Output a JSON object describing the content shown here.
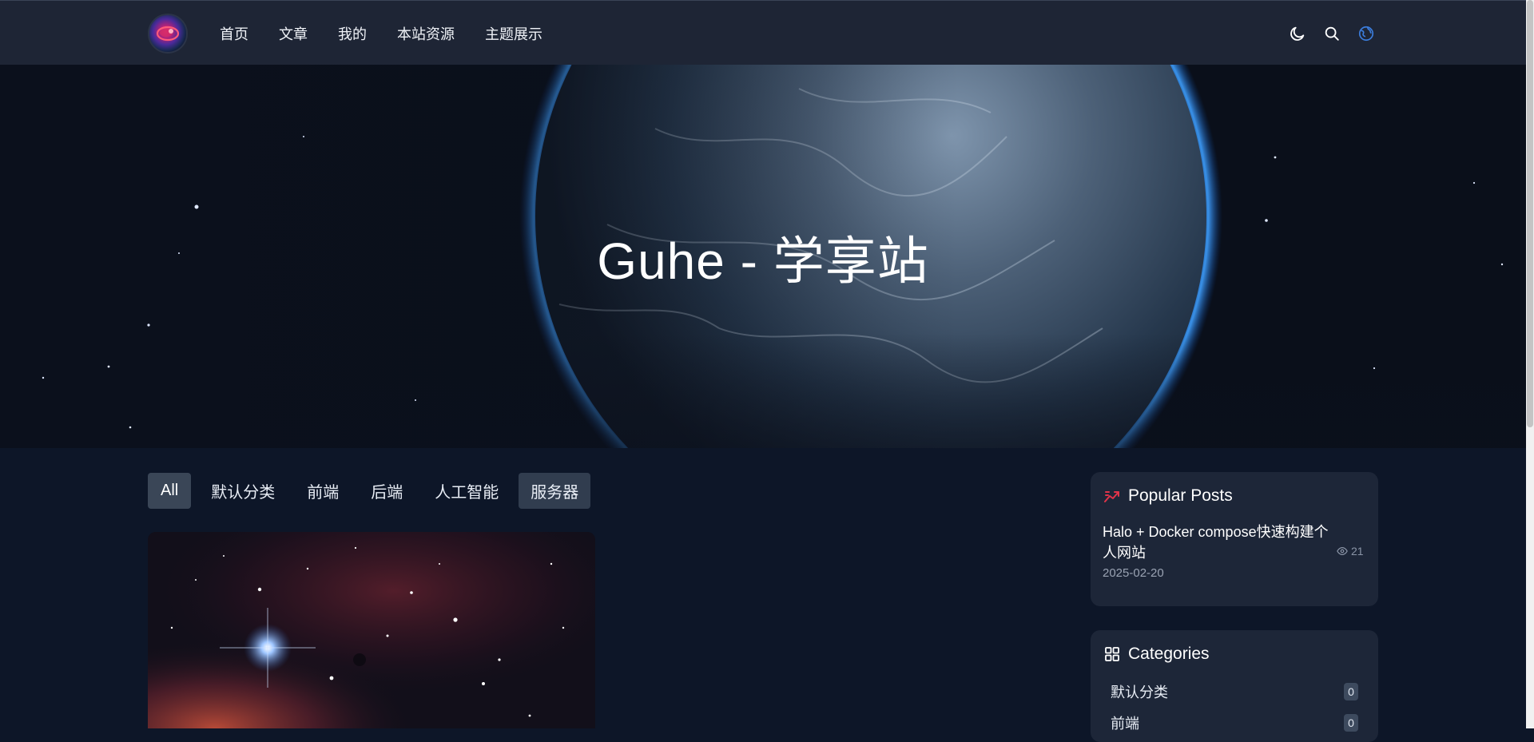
{
  "site": {
    "title": "Guhe - 学享站",
    "logo_icon": "site-logo"
  },
  "nav": {
    "items": [
      {
        "label": "首页"
      },
      {
        "label": "文章"
      },
      {
        "label": "我的"
      },
      {
        "label": "本站资源"
      },
      {
        "label": "主题展示"
      }
    ],
    "actions": [
      {
        "icon": "moon-icon"
      },
      {
        "icon": "search-icon"
      },
      {
        "icon": "globe-icon"
      }
    ]
  },
  "tabs": [
    {
      "label": "All",
      "active": true
    },
    {
      "label": "默认分类"
    },
    {
      "label": "前端"
    },
    {
      "label": "后端"
    },
    {
      "label": "人工智能"
    },
    {
      "label": "服务器"
    }
  ],
  "popular": {
    "title": "Popular Posts",
    "post_title": "Halo + Docker compose快速构建个人网站",
    "views": "21",
    "date": "2025-02-20"
  },
  "categories": {
    "title": "Categories",
    "items": [
      {
        "name": "默认分类",
        "count": "0"
      },
      {
        "name": "前端",
        "count": "0"
      }
    ]
  },
  "colors": {
    "page_bg": "#0d1628",
    "nav_bg": "#1e2535",
    "widget_bg": "#1d2638",
    "accent_blue": "#3b7ddd",
    "accent_red": "#e0344a"
  }
}
